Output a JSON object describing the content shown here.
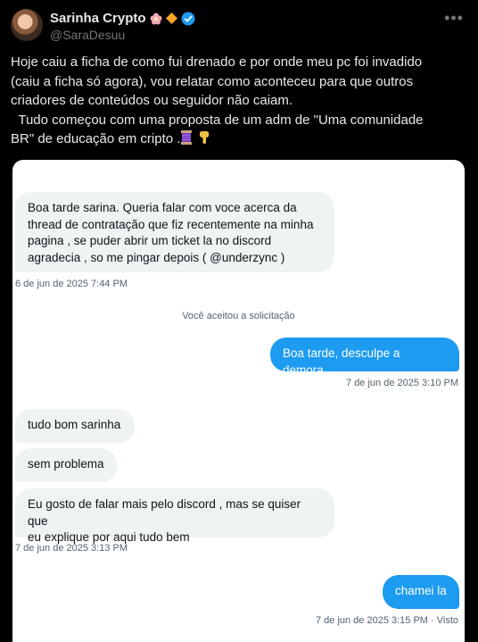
{
  "author": {
    "display_name": "Sarinha Crypto",
    "handle": "@SaraDesuu",
    "icons": [
      "flower-icon",
      "orange-diamond-icon",
      "verified-badge-icon"
    ]
  },
  "post": {
    "line1": "Hoje caiu a ficha de como fui drenado e por onde meu pc foi invadido",
    "line2": "(caiu a ficha só agora), vou relatar como aconteceu para que outros",
    "line3": "criadores de conteúdos ou seguidor não caiam.",
    "line4": "  Tudo começou com uma proposta de um adm de \"Uma comunidade",
    "line5": "BR\" de educação em cripto ."
  },
  "chat": {
    "msg1_line1": "Boa tarde sarina. Queria falar com voce acerca da",
    "msg1_line2": "thread de contratação que fiz recentemente na minha",
    "msg1_line3": "pagina , se puder abrir um ticket la no discord",
    "msg1_line4": "agradecia , so me pingar depois ( @underzync )",
    "ts1": "6 de jun de 2025 7:44 PM",
    "system": "Você aceitou a solicitação",
    "msg2": "Boa tarde, desculpe a demora.",
    "ts2": "7 de jun de 2025 3:10 PM",
    "msg3": "tudo bom sarinha",
    "msg4": "sem problema",
    "msg5_line1": "Eu gosto de falar mais pelo discord , mas se quiser que",
    "msg5_line2": "eu explique por aqui tudo bem",
    "ts3": "7 de jun de 2025 3:13 PM",
    "msg6": "chamei la",
    "ts4": "7 de jun de 2025 3:15 PM · Visto"
  },
  "colors": {
    "background": "#000000",
    "text": "#e7e9ea",
    "muted": "#71767b",
    "verified": "#1d9bf0",
    "outgoing_bubble": "#1d9bf0",
    "incoming_bubble": "#eff3f4"
  }
}
